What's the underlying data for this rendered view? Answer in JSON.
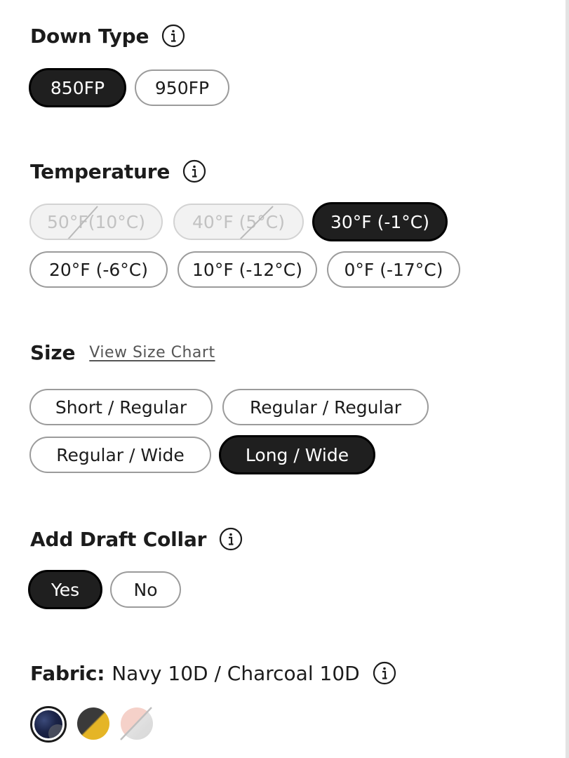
{
  "down_type": {
    "title": "Down Type",
    "options": [
      "850FP",
      "950FP"
    ],
    "selected": "850FP"
  },
  "temperature": {
    "title": "Temperature",
    "options": [
      "50°F(10°C)",
      "40°F (5°C)",
      "30°F (-1°C)",
      "20°F (-6°C)",
      "10°F (-12°C)",
      "0°F (-17°C)"
    ],
    "selected": "30°F (-1°C)",
    "unavailable": [
      "50°F(10°C)",
      "40°F (5°C)"
    ]
  },
  "size": {
    "title": "Size",
    "chart_link": "View Size Chart",
    "options": [
      "Short / Regular",
      "Regular / Regular",
      "Regular / Wide",
      "Long / Wide"
    ],
    "selected": "Long / Wide"
  },
  "draft_collar": {
    "title": "Add Draft Collar",
    "options": [
      "Yes",
      "No"
    ],
    "selected": "Yes"
  },
  "fabric": {
    "label": "Fabric:",
    "value": "Navy 10D / Charcoal 10D",
    "swatches": [
      {
        "name": "navy-swatch",
        "colors": [
          "#1b2448",
          "#5c6068"
        ],
        "selected": true
      },
      {
        "name": "charcoal-swatch",
        "colors": [
          "#3a3a3a",
          "#e5b526"
        ],
        "selected": false
      },
      {
        "name": "unavailable-swatch",
        "colors": [
          "#f4c9c0",
          "#d0d0d0"
        ],
        "selected": false,
        "unavailable": true
      }
    ]
  },
  "icons": {
    "info": "info-icon"
  },
  "colors": {
    "selected_fill": "#1f1f1f",
    "pill_border": "#9b9b9b",
    "disabled_fill": "#f2f2f2",
    "disabled_text": "#c2c2c2"
  }
}
